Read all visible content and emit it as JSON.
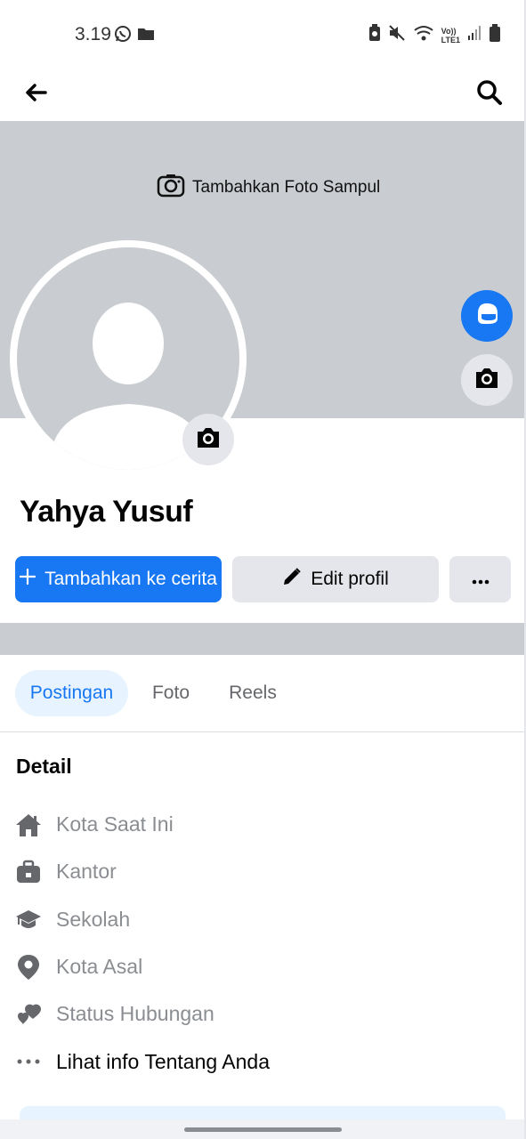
{
  "status_bar": {
    "time": "3.19",
    "left_icons": [
      "whatsapp-icon",
      "folder-icon"
    ],
    "right_icons": [
      "battery-saver-icon",
      "mute-icon",
      "wifi-icon",
      "volte-icon",
      "signal-icon",
      "battery-icon"
    ],
    "volte_text": "Vo))",
    "lte_text": "LTE1"
  },
  "nav": {
    "back_icon": "arrow-left-icon",
    "search_icon": "search-icon"
  },
  "cover": {
    "add_cover_label": "Tambahkan Foto Sampul",
    "avatar_button_icon": "avatar-creator-icon",
    "camera_button_icon": "camera-icon"
  },
  "profile": {
    "name": "Yahya Yusuf"
  },
  "actions": {
    "add_story_label": "Tambahkan ke cerita",
    "edit_profile_label": "Edit profil",
    "more_icon": "more-icon"
  },
  "tabs": [
    {
      "label": "Postingan",
      "active": true
    },
    {
      "label": "Foto",
      "active": false
    },
    {
      "label": "Reels",
      "active": false
    }
  ],
  "details": {
    "title": "Detail",
    "items": [
      {
        "icon": "home-icon",
        "label": "Kota Saat Ini"
      },
      {
        "icon": "briefcase-icon",
        "label": "Kantor"
      },
      {
        "icon": "graduation-cap-icon",
        "label": "Sekolah"
      },
      {
        "icon": "location-pin-icon",
        "label": "Kota Asal"
      },
      {
        "icon": "hearts-icon",
        "label": "Status Hubungan"
      },
      {
        "icon": "more-icon",
        "label": "Lihat info Tentang Anda"
      }
    ]
  },
  "colors": {
    "primary": "#1877f2",
    "cover_gray": "#c9ccd1",
    "secondary_button": "#e4e6eb",
    "active_tab_bg": "#e7f3ff",
    "muted_text": "#8a8d91"
  }
}
